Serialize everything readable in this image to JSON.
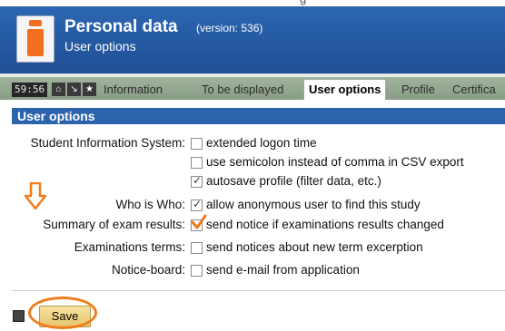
{
  "header": {
    "title": "Personal data",
    "version": "(version: 536)",
    "subtitle": "User options"
  },
  "tabbar": {
    "clock": "59:56",
    "icons": [
      "home-icon",
      "download-icon",
      "star-icon"
    ],
    "tabs": [
      {
        "label": "Information",
        "active": false
      },
      {
        "label": "To be displayed",
        "active": false
      },
      {
        "label": "User options",
        "active": true
      },
      {
        "label": "Profile",
        "active": false
      },
      {
        "label": "Certifica",
        "active": false
      }
    ]
  },
  "section": {
    "title": "User options"
  },
  "form": {
    "groups": [
      {
        "label": "Student Information System:",
        "options": [
          {
            "text": "extended logon time",
            "checked": false
          },
          {
            "text": "use semicolon instead of comma in CSV export",
            "checked": false
          },
          {
            "text": "autosave profile (filter data, etc.)",
            "checked": true
          }
        ]
      },
      {
        "label": "Who is Who:",
        "options": [
          {
            "text": "allow anonymous user to find this study",
            "checked": true
          }
        ]
      },
      {
        "label": "Summary of exam results:",
        "options": [
          {
            "text": "send notice if examinations results changed",
            "checked": true
          }
        ]
      },
      {
        "label": "Examinations terms:",
        "options": [
          {
            "text": "send notices about new term excerption",
            "checked": false
          }
        ]
      },
      {
        "label": "Notice-board:",
        "options": [
          {
            "text": "send e-mail from application",
            "checked": false
          }
        ]
      }
    ]
  },
  "footer": {
    "save_label": "Save"
  },
  "colors": {
    "header": "#2c66b2",
    "section_bar": "#2b63ad",
    "highlight": "#f07c1b"
  }
}
